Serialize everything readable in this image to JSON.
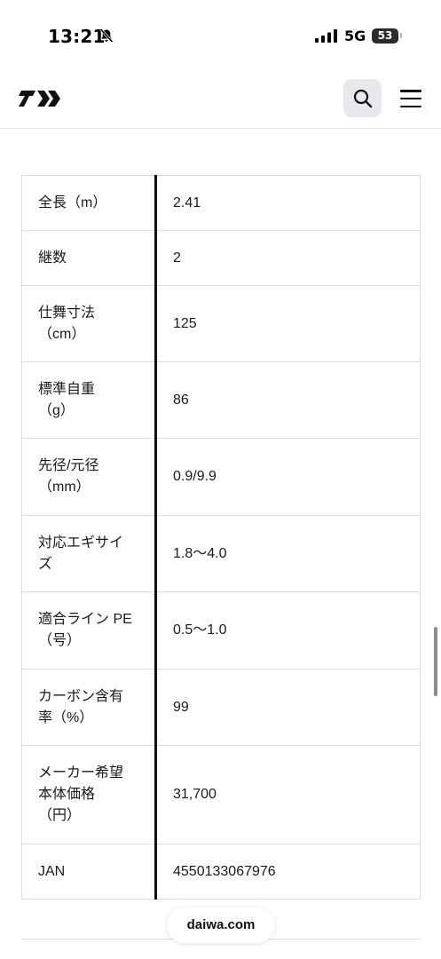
{
  "status_bar": {
    "time": "13:21",
    "network": "5G",
    "battery": "53",
    "icons": {
      "mute": "bell-slash-icon",
      "signal": "signal-bars-icon",
      "battery": "battery-icon"
    }
  },
  "header": {
    "logo_icon": "daiwa-logo",
    "search_icon": "search-icon",
    "menu_icon": "hamburger-menu-icon"
  },
  "spec_table": {
    "rows": [
      {
        "label": "全長（m）",
        "value": "2.41"
      },
      {
        "label": "継数",
        "value": "2"
      },
      {
        "label": "仕舞寸法\n（cm）",
        "value": "125"
      },
      {
        "label": "標準自重\n（g）",
        "value": "86"
      },
      {
        "label": "先径/元径\n（mm）",
        "value": "0.9/9.9"
      },
      {
        "label": "対応エギサイ\nズ",
        "value": "1.8〜4.0"
      },
      {
        "label": "適合ライン PE\n（号）",
        "value": "0.5〜1.0"
      },
      {
        "label": "カーボン含有\n率（%）",
        "value": "99"
      },
      {
        "label": "メーカー希望\n本体価格\n（円）",
        "value": "31,700"
      },
      {
        "label": "JAN",
        "value": "4550133067976"
      }
    ]
  },
  "browser": {
    "url": "daiwa.com"
  },
  "colors": {
    "text": "#1a1a1a",
    "divider": "#dcdcdc",
    "search_bg": "#e8e9ee",
    "accent_rule": "#111111"
  }
}
